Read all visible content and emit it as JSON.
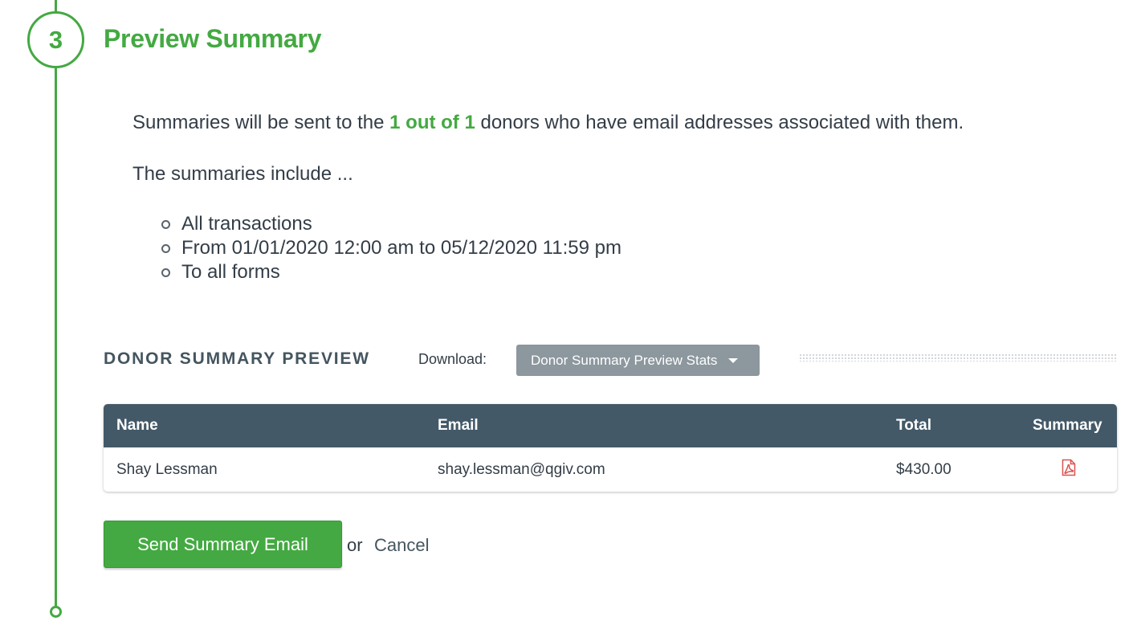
{
  "step": {
    "number": "3",
    "title": "Preview Summary"
  },
  "intro": {
    "prefix": "Summaries will be sent to the ",
    "highlight": "1 out of 1",
    "suffix": " donors who have email addresses associated with them."
  },
  "includes_label": "The summaries include ...",
  "criteria": [
    "All transactions",
    "From 01/01/2020 12:00 am to 05/12/2020 11:59 pm",
    "To all forms"
  ],
  "preview": {
    "heading": "DONOR SUMMARY PREVIEW",
    "download_label": "Download:",
    "download_button": "Donor Summary Preview Stats"
  },
  "table": {
    "columns": [
      "Name",
      "Email",
      "Total",
      "Summary"
    ],
    "rows": [
      {
        "name": "Shay Lessman",
        "email": "shay.lessman@qgiv.com",
        "total": "$430.00",
        "summary_icon": "pdf-icon"
      }
    ]
  },
  "actions": {
    "send_label": "Send Summary Email",
    "or_text": "or",
    "cancel_label": "Cancel"
  },
  "colors": {
    "accent_green": "#44a942",
    "table_header": "#435968",
    "pdf_red": "#d9534f",
    "button_gray": "#8c979e"
  }
}
